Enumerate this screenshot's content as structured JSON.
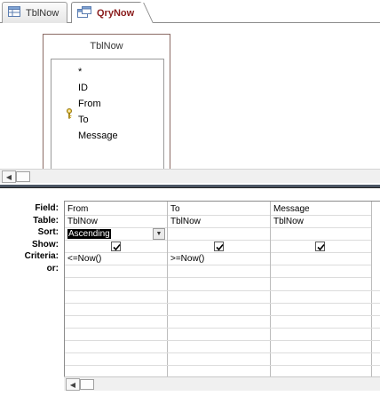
{
  "tabs": [
    {
      "label": "TblNow",
      "icon": "table-icon",
      "active": false
    },
    {
      "label": "QryNow",
      "icon": "query-icon",
      "active": true
    }
  ],
  "table_box": {
    "title": "TblNow",
    "fields": [
      "*",
      "ID",
      "From",
      "To",
      "Message"
    ],
    "primary_key_field": "ID"
  },
  "grid": {
    "row_labels": [
      "Field:",
      "Table:",
      "Sort:",
      "Show:",
      "Criteria:",
      "or:"
    ],
    "columns": [
      {
        "field": "From",
        "table": "TblNow",
        "sort": "Ascending",
        "show": true,
        "criteria": "<=Now()"
      },
      {
        "field": "To",
        "table": "TblNow",
        "sort": "",
        "show": true,
        "criteria": ">=Now()"
      },
      {
        "field": "Message",
        "table": "TblNow",
        "sort": "",
        "show": true,
        "criteria": ""
      }
    ]
  },
  "colors": {
    "active_tab_text": "#8a1c1c",
    "splitter": "#4a5563",
    "table_border": "#8b6b64"
  }
}
